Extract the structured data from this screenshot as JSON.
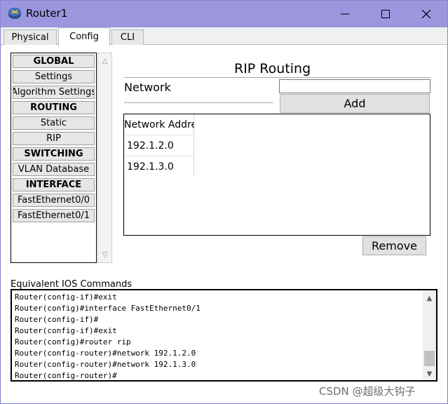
{
  "window": {
    "title": "Router1",
    "icon": "router-app-icon"
  },
  "tabs": [
    {
      "label": "Physical",
      "active": false
    },
    {
      "label": "Config",
      "active": true
    },
    {
      "label": "CLI",
      "active": false
    }
  ],
  "nav": {
    "items": [
      {
        "label": "GLOBAL",
        "header": true
      },
      {
        "label": "Settings",
        "header": false
      },
      {
        "label": "Algorithm Settings",
        "header": false
      },
      {
        "label": "ROUTING",
        "header": true
      },
      {
        "label": "Static",
        "header": false
      },
      {
        "label": "RIP",
        "header": false
      },
      {
        "label": "SWITCHING",
        "header": true
      },
      {
        "label": "VLAN Database",
        "header": false
      },
      {
        "label": "INTERFACE",
        "header": true
      },
      {
        "label": "FastEthernet0/0",
        "header": false
      },
      {
        "label": "FastEthernet0/1",
        "header": false
      }
    ]
  },
  "rip": {
    "title": "RIP Routing",
    "network_label": "Network",
    "network_value": "",
    "add_label": "Add",
    "remove_label": "Remove",
    "column_header": "Network Address",
    "networks": [
      "192.1.2.0",
      "192.1.3.0"
    ]
  },
  "ios": {
    "label": "Equivalent IOS Commands",
    "lines": [
      "Router(config-if)#exit",
      "Router(config)#interface FastEthernet0/1",
      "Router(config-if)#",
      "Router(config-if)#exit",
      "Router(config)#router rip",
      "Router(config-router)#network 192.1.2.0",
      "Router(config-router)#network 192.1.3.0",
      "Router(config-router)#"
    ]
  },
  "watermark": "CSDN @超级大钩子",
  "colors": {
    "titlebar": "#9b96dd",
    "window_border": "#8a82d6",
    "button_face": "#e1e1e1"
  }
}
